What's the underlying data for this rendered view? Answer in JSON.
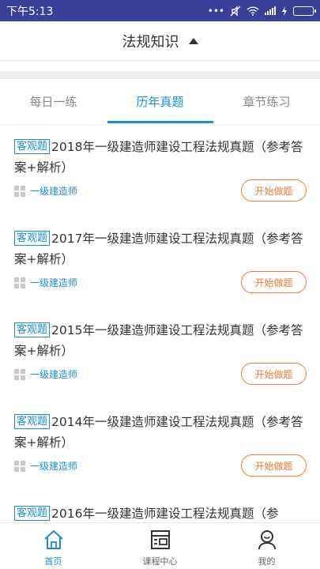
{
  "status_bar": {
    "time": "下午5:13"
  },
  "header": {
    "title": "法规知识"
  },
  "tabs": [
    {
      "label": "每日一练",
      "active": false
    },
    {
      "label": "历年真题",
      "active": true
    },
    {
      "label": "章节练习",
      "active": false
    }
  ],
  "items": [
    {
      "tag": "客观题",
      "title": "2018年一级建造师建设工程法规真题（参考答案+解析）",
      "category": "一级建造师",
      "button": "开始做题"
    },
    {
      "tag": "客观题",
      "title": "2017年一级建造师建设工程法规真题（参考答案+解析）",
      "category": "一级建造师",
      "button": "开始做题"
    },
    {
      "tag": "客观题",
      "title": "2015年一级建造师建设工程法规真题（参考答案+解析）",
      "category": "一级建造师",
      "button": "开始做题"
    },
    {
      "tag": "客观题",
      "title": "2014年一级建造师建设工程法规真题（参考答案+解析）",
      "category": "一级建造师",
      "button": "开始做题"
    },
    {
      "tag": "客观题",
      "title": "2016年一级建造师建设工程法规真题（参",
      "category": "",
      "button": ""
    }
  ],
  "bottom_nav": [
    {
      "label": "首页",
      "icon": "home-icon",
      "active": true
    },
    {
      "label": "课程中心",
      "icon": "course-icon",
      "active": false
    },
    {
      "label": "我的",
      "icon": "profile-icon",
      "active": false
    }
  ],
  "colors": {
    "accent": "#1a8fd8",
    "button": "#f07a36",
    "status_bar": "#3a3f9a"
  }
}
